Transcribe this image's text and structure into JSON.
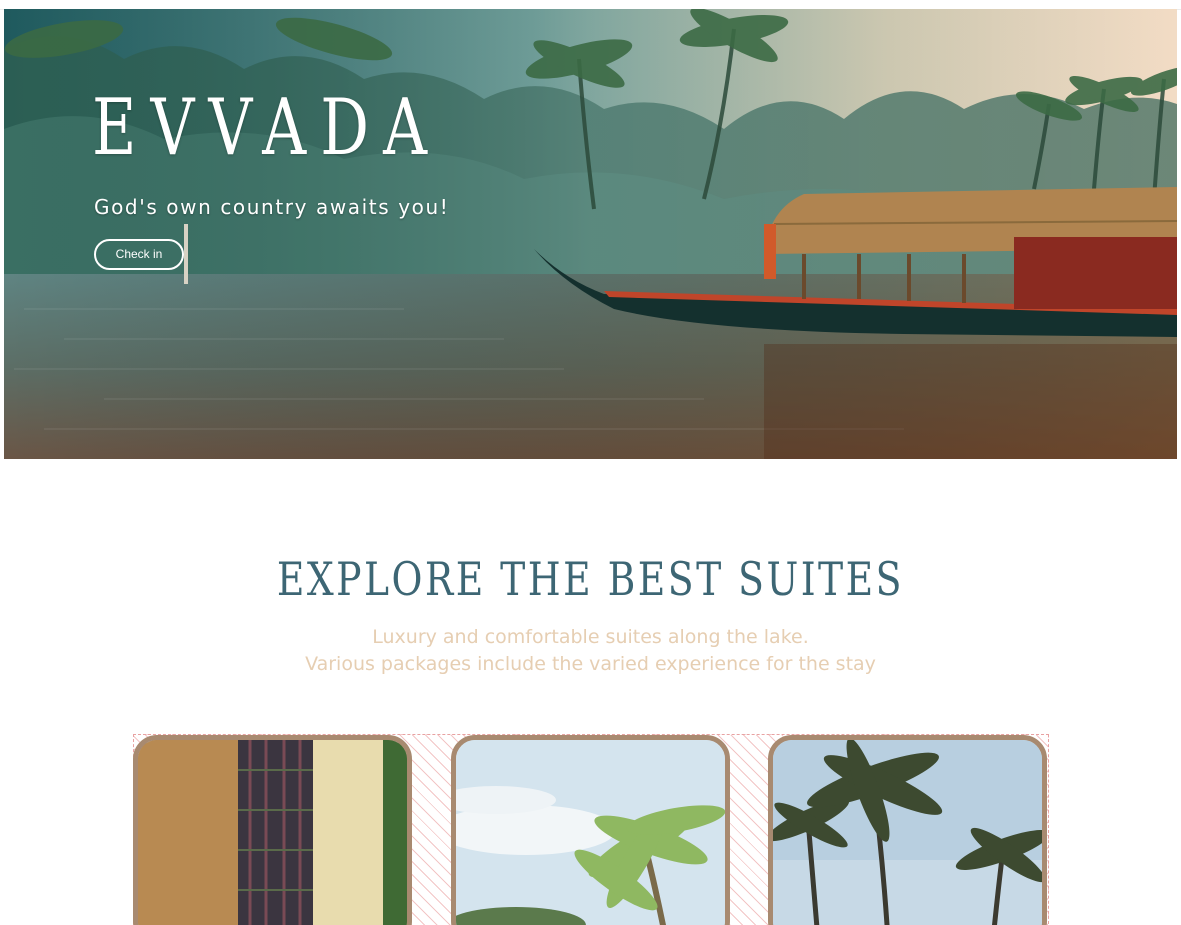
{
  "hero": {
    "brand": "EVVADA",
    "tagline": "God's own country awaits you!",
    "checkin_label": "Check in"
  },
  "suites": {
    "title": "EXPLORE THE BEST SUITES",
    "subtitle_line1": "Luxury and comfortable suites along the lake.",
    "subtitle_line2": "Various packages include the varied experience for the stay",
    "cards": [
      {
        "image": "suite-room-curtains"
      },
      {
        "image": "palm-tree-sky"
      },
      {
        "image": "coconut-palms-sky"
      }
    ]
  },
  "colors": {
    "title": "#3d6674",
    "subtitle": "#e6ceb2",
    "card_border": "#a88a70",
    "hero_text": "#ffffff"
  }
}
